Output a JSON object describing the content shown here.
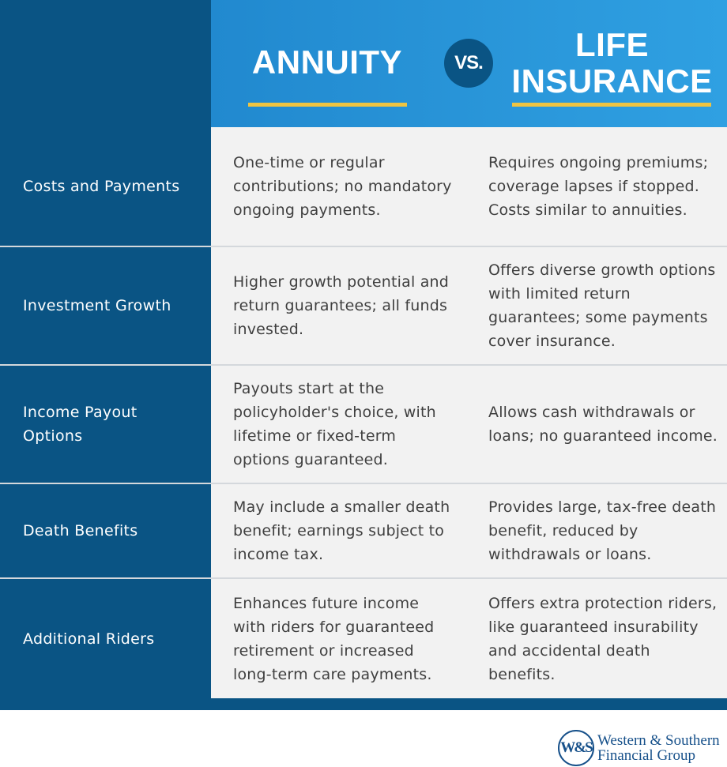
{
  "header": {
    "left_title": "ANNUITY",
    "vs_label": "VS.",
    "right_title_line1": "LIFE",
    "right_title_line2": "INSURANCE"
  },
  "colors": {
    "dark_blue": "#0a5484",
    "header_blue": "#2a97da",
    "accent_yellow": "#efc441",
    "cell_bg": "#f2f2f2",
    "body_text": "#3f3f3f"
  },
  "rows": [
    {
      "label": "Costs and Payments",
      "annuity": "One-time or regular contributions; no mandatory ongoing payments.",
      "life_insurance": "Requires ongoing premiums; coverage lapses if stopped. Costs similar to annuities."
    },
    {
      "label": "Investment Growth",
      "annuity": "Higher growth potential and return guarantees; all funds invested.",
      "life_insurance": "Offers diverse growth options with limited return guarantees; some payments cover insurance."
    },
    {
      "label": "Income Payout Options",
      "annuity": "Payouts start at the policyholder's choice, with lifetime or fixed-term options guaranteed.",
      "life_insurance": "Allows cash withdrawals or loans; no guaranteed income."
    },
    {
      "label": "Death Benefits",
      "annuity": "May include a smaller death benefit; earnings subject to income tax.",
      "life_insurance": "Provides large, tax-free death benefit, reduced by withdrawals or loans."
    },
    {
      "label": "Additional Riders",
      "annuity": "Enhances future income with riders for guaranteed retirement or increased long-term care payments.",
      "life_insurance": "Offers extra protection riders, like guaranteed insurability and accidental death benefits."
    }
  ],
  "footer": {
    "logo_mark": "W&S",
    "logo_line1": "Western & Southern",
    "logo_line2": "Financial Group"
  }
}
